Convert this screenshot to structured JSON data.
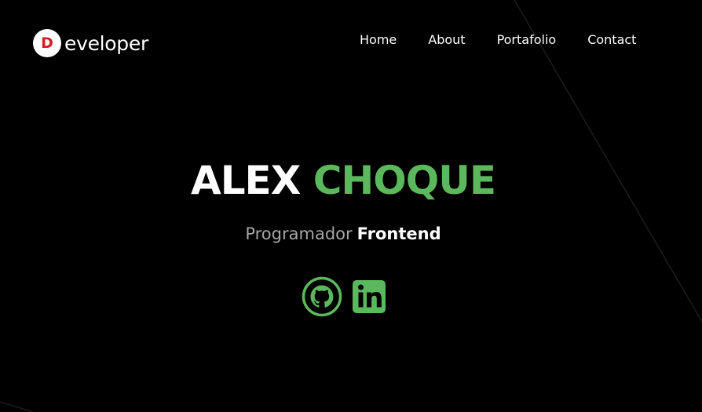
{
  "colors": {
    "background": "#000000",
    "accent": "#5cb85c",
    "logo_red": "#d32027",
    "muted_text": "#a6a6a6"
  },
  "logo": {
    "letter": "D",
    "text": "eveloper"
  },
  "nav": {
    "items": [
      {
        "label": "Home"
      },
      {
        "label": "About"
      },
      {
        "label": "Portafolio"
      },
      {
        "label": "Contact"
      }
    ]
  },
  "hero": {
    "name_first": "ALEX",
    "name_last": "CHOQUE",
    "role_first": "Programador",
    "role_second": "Frontend"
  },
  "social": {
    "github_icon": "github-icon",
    "linkedin_icon": "linkedin-icon"
  }
}
